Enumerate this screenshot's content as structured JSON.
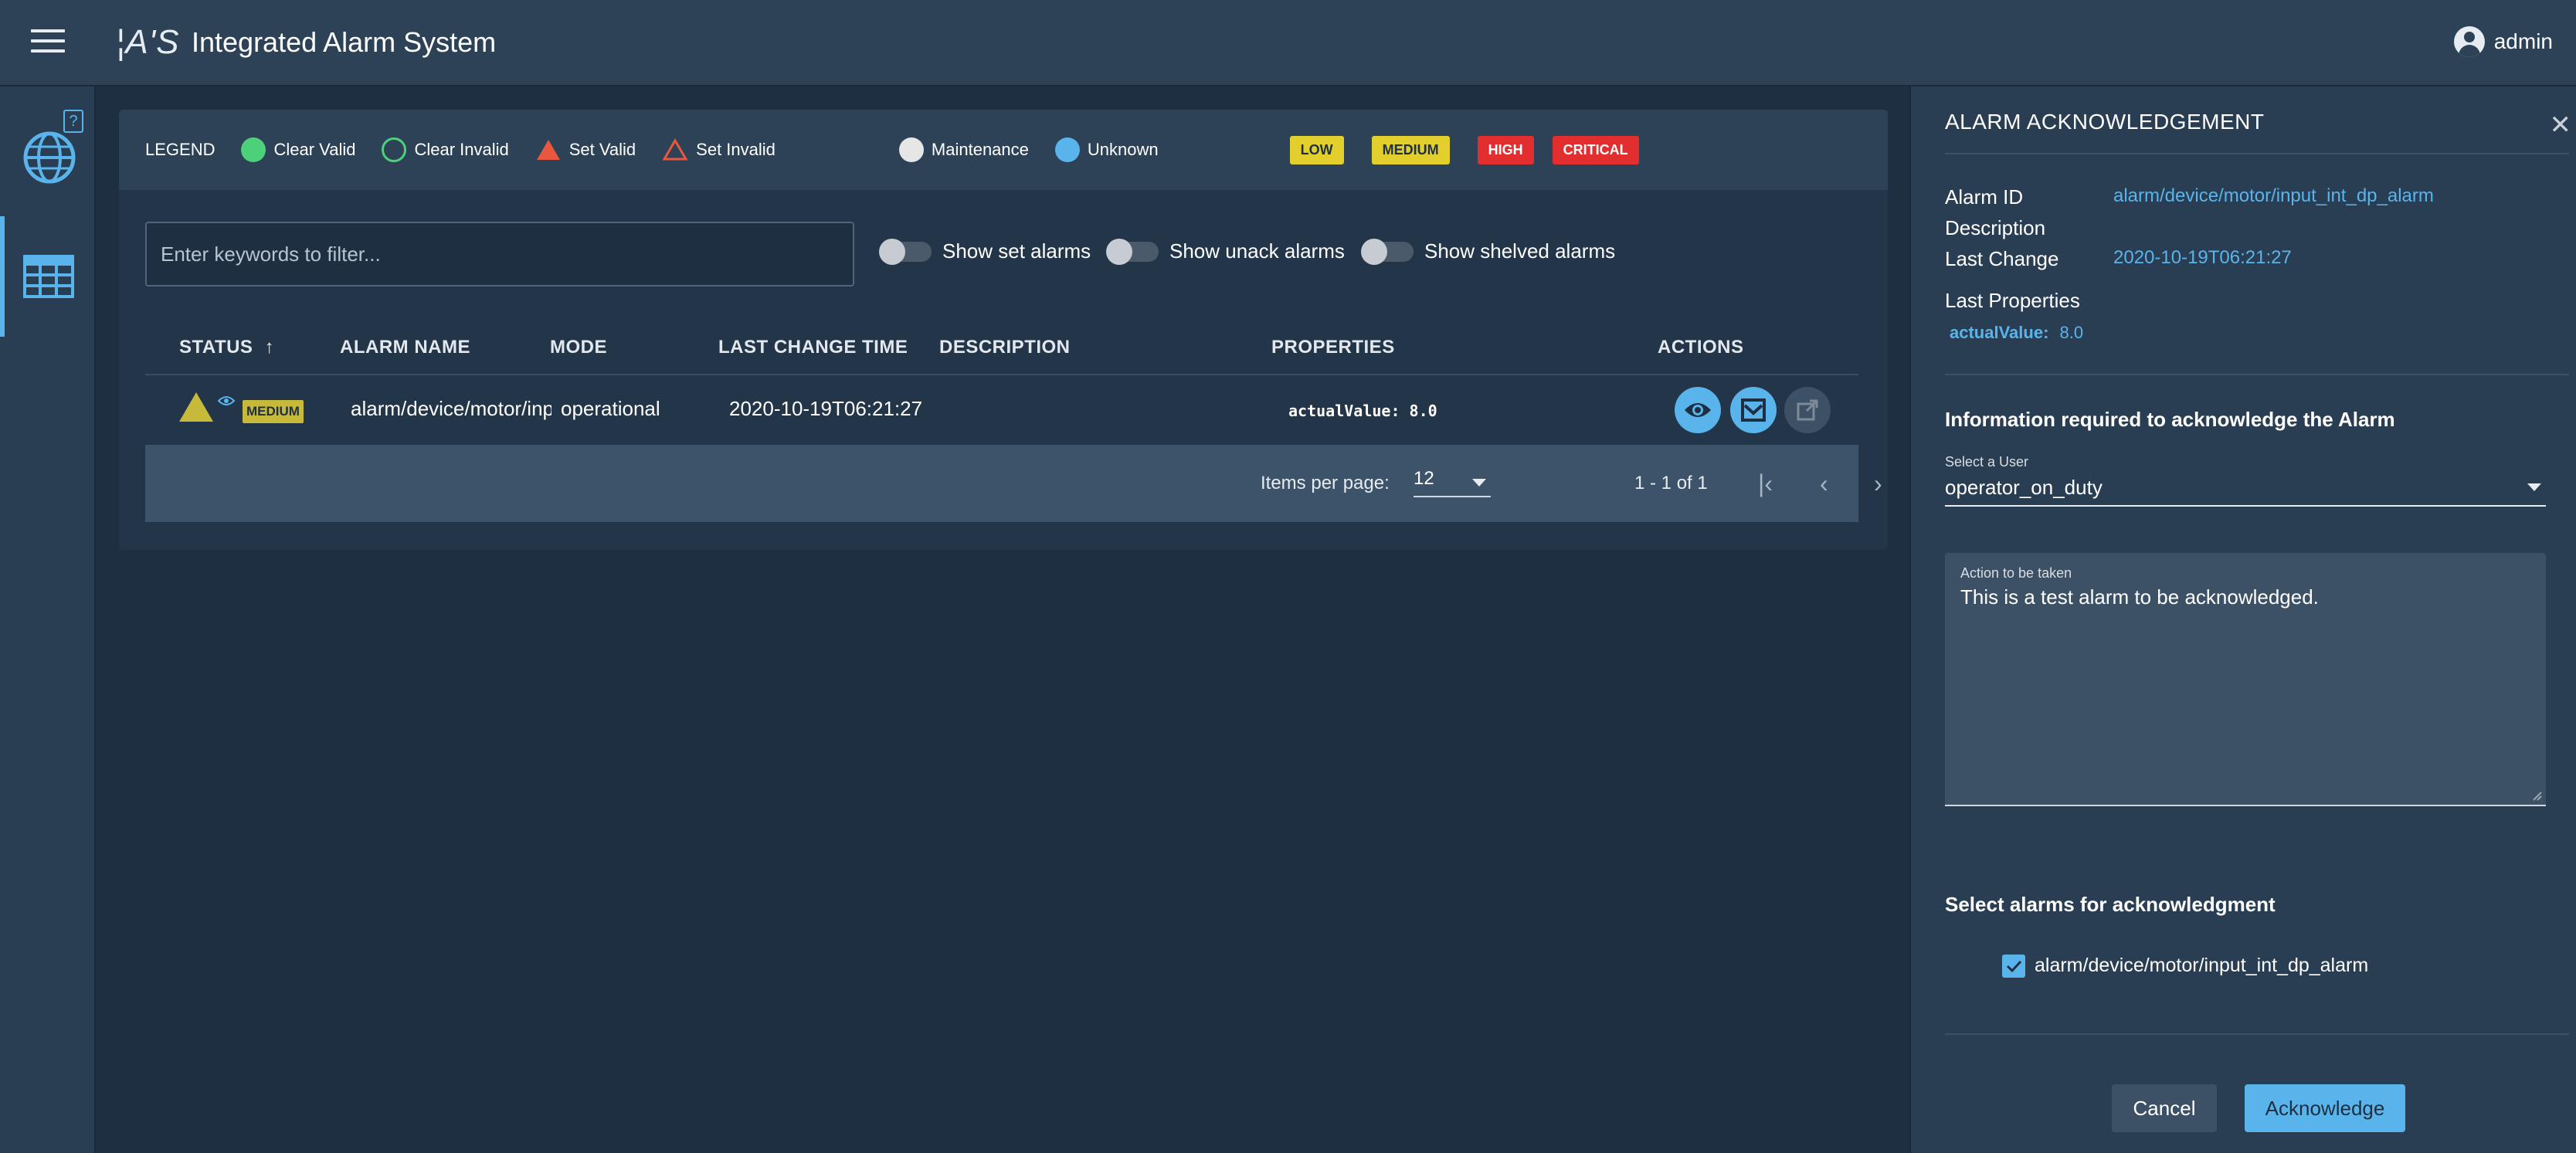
{
  "header": {
    "logo": "¦A'S",
    "title": "Integrated Alarm System",
    "user": "admin"
  },
  "sidebar": {
    "help": "?",
    "items": [
      {
        "name": "globe-icon"
      },
      {
        "name": "table-icon",
        "active": true
      }
    ]
  },
  "legend": {
    "label": "LEGEND",
    "items": [
      "Clear Valid",
      "Clear Invalid",
      "Set Valid",
      "Set Invalid",
      "Maintenance",
      "Unknown"
    ],
    "severities": [
      "LOW",
      "MEDIUM",
      "HIGH",
      "CRITICAL"
    ]
  },
  "filter": {
    "placeholder": "Enter keywords to filter...",
    "toggles": [
      "Show set alarms",
      "Show unack alarms",
      "Show shelved alarms"
    ]
  },
  "table": {
    "columns": [
      "STATUS",
      "ALARM NAME",
      "MODE",
      "LAST CHANGE TIME",
      "DESCRIPTION",
      "PROPERTIES",
      "ACTIONS"
    ],
    "sort_indicator": "↑",
    "rows": [
      {
        "priority": "MEDIUM",
        "name": "alarm/device/motor/inp",
        "mode": "operational",
        "last_change": "2020-10-19T06:21:27",
        "description": "",
        "properties": "actualValue: 8.0"
      }
    ]
  },
  "paginator": {
    "items_per_page_label": "Items per page:",
    "items_per_page": "12",
    "range": "1 - 1 of 1"
  },
  "ack_panel": {
    "title": "ALARM ACKNOWLEDGEMENT",
    "close": "✕",
    "alarm_id_label": "Alarm ID",
    "alarm_id": "alarm/device/motor/input_int_dp_alarm",
    "description_label": "Description",
    "last_change_label": "Last Change",
    "last_change": "2020-10-19T06:21:27",
    "last_properties_label": "Last Properties",
    "property_key": "actualValue:",
    "property_value": "8.0",
    "info_heading": "Information required to acknowledge the Alarm",
    "select_user_label": "Select a User",
    "selected_user": "operator_on_duty",
    "action_label": "Action to be taken",
    "action_value": "This is a test alarm to be acknowledged.",
    "select_alarms_heading": "Select alarms for acknowledgment",
    "alarm_checkbox_label": "alarm/device/motor/input_int_dp_alarm",
    "cancel": "Cancel",
    "acknowledge": "Acknowledge"
  },
  "colors": {
    "accent": "#5ab4ec",
    "clear_valid": "#4cd07a",
    "set_valid": "#e9573f",
    "low": "#e2cf2e",
    "medium": "#e2cf2e",
    "high": "#e22e2e",
    "critical": "#e22e2e"
  }
}
